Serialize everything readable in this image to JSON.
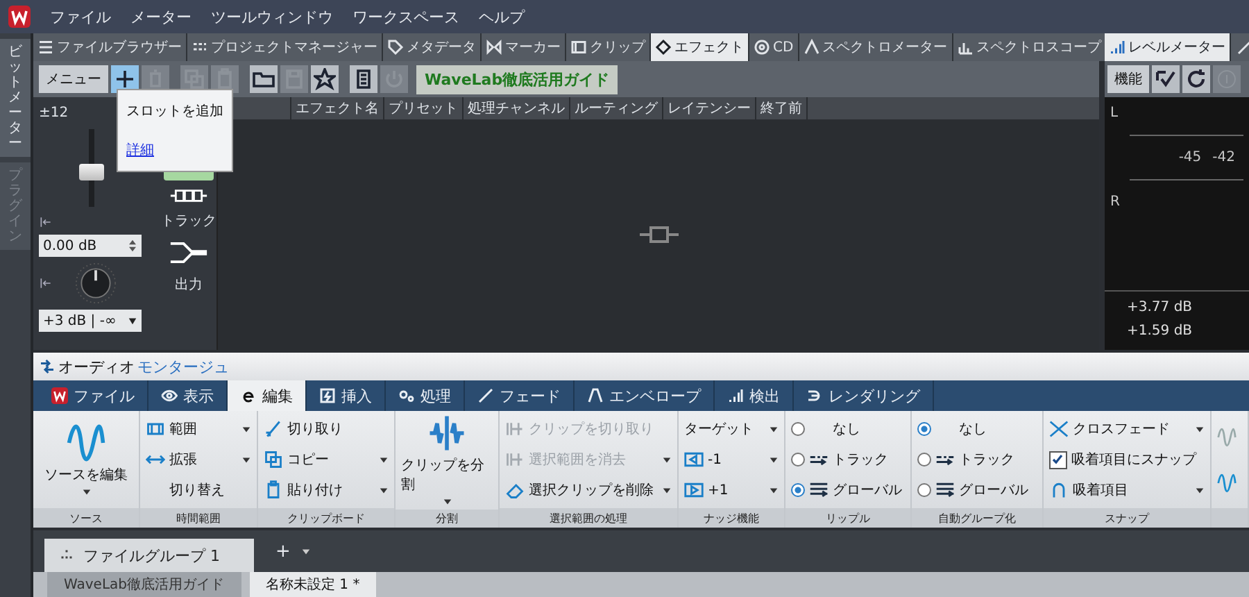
{
  "menu": [
    "ファイル",
    "メーター",
    "ツールウィンドウ",
    "ワークスペース",
    "ヘルプ"
  ],
  "side_tabs": [
    {
      "label": "ビットメーター",
      "selected": true
    },
    {
      "label": "プラグイン",
      "selected": false
    }
  ],
  "tool_tabs": [
    {
      "label": "ファイルブラウザー",
      "selected": false
    },
    {
      "label": "プロジェクトマネージャー",
      "selected": false
    },
    {
      "label": "メタデータ",
      "selected": false
    },
    {
      "label": "マーカー",
      "selected": false
    },
    {
      "label": "クリップ",
      "selected": false
    },
    {
      "label": "エフェクト",
      "selected": true
    },
    {
      "label": "CD",
      "selected": false
    },
    {
      "label": "スペクトロメーター",
      "selected": false
    },
    {
      "label": "スペクトロスコープ",
      "selected": false
    }
  ],
  "toolbar": {
    "menu_button": "メニュー",
    "guide_button": "WaveLab徹底活用ガイド",
    "tools": [
      {
        "kind": "add",
        "disabled": false,
        "selected": true
      },
      {
        "kind": "trash",
        "disabled": true,
        "selected": false
      },
      {
        "kind": "copy",
        "disabled": true,
        "selected": false
      },
      {
        "kind": "paste",
        "disabled": true,
        "selected": false
      },
      {
        "kind": "folder",
        "disabled": false,
        "selected": false
      },
      {
        "kind": "save",
        "disabled": true,
        "selected": false
      },
      {
        "kind": "star",
        "disabled": false,
        "selected": false
      },
      {
        "kind": "doc",
        "disabled": false,
        "selected": false
      },
      {
        "kind": "power",
        "disabled": true,
        "selected": false
      }
    ]
  },
  "tooltip": {
    "text": "スロットを追加",
    "link": "詳細"
  },
  "mixer": {
    "scale": "±12",
    "level": 0.45,
    "gain": "0.00 dB",
    "output_mode": "+3 dB | -∞",
    "track_label": "トラック",
    "output_label": "出力"
  },
  "effect_columns": [
    "エフェクト名",
    "プリセット",
    "処理チャンネル",
    "ルーティング",
    "レイテンシー",
    "終了前"
  ],
  "meter_panel": {
    "tabs": [
      {
        "label": "レベルメーター",
        "selected": true
      }
    ],
    "function_button": "機能",
    "channels": [
      "L",
      "R"
    ],
    "scale": [
      "-45",
      "-42"
    ],
    "readings": [
      "+3.77 dB",
      "+1.59 dB"
    ]
  },
  "montage": {
    "title_parts": [
      {
        "text": "オーディオ",
        "accent": false
      },
      {
        "text": "モンタージュ",
        "accent": true
      }
    ],
    "ribbon_tabs": [
      {
        "label": "ファイル",
        "selected": false
      },
      {
        "label": "表示",
        "selected": false
      },
      {
        "label": "編集",
        "selected": true
      },
      {
        "label": "挿入",
        "selected": false
      },
      {
        "label": "処理",
        "selected": false
      },
      {
        "label": "フェード",
        "selected": false
      },
      {
        "label": "エンベロープ",
        "selected": false
      },
      {
        "label": "検出",
        "selected": false
      },
      {
        "label": "レンダリング",
        "selected": false
      }
    ],
    "groups": [
      {
        "label": "ソース",
        "items": [
          {
            "kind": "large",
            "label": "ソースを編集",
            "dropdown": true,
            "disabled": false
          }
        ]
      },
      {
        "label": "時間範囲",
        "items": [
          {
            "kind": "small",
            "label": "範囲",
            "dropdown": true,
            "disabled": false
          },
          {
            "kind": "small",
            "label": "拡張",
            "dropdown": true,
            "disabled": false
          },
          {
            "kind": "small",
            "label": "切り替え",
            "dropdown": false,
            "disabled": false
          }
        ]
      },
      {
        "label": "クリップボード",
        "items": [
          {
            "kind": "small",
            "label": "切り取り",
            "dropdown": false,
            "disabled": false
          },
          {
            "kind": "small",
            "label": "コピー",
            "dropdown": true,
            "disabled": false
          },
          {
            "kind": "small",
            "label": "貼り付け",
            "dropdown": true,
            "disabled": false
          }
        ]
      },
      {
        "label": "分割",
        "items": [
          {
            "kind": "large",
            "label": "クリップを分割",
            "dropdown": true,
            "disabled": false
          }
        ]
      },
      {
        "label": "選択範囲の処理",
        "items": [
          {
            "kind": "small",
            "label": "クリップを切り取り",
            "dropdown": false,
            "disabled": true
          },
          {
            "kind": "small",
            "label": "選択範囲を消去",
            "dropdown": true,
            "disabled": true
          },
          {
            "kind": "small",
            "label": "選択クリップを削除",
            "dropdown": true,
            "disabled": false
          }
        ]
      },
      {
        "label": "ナッジ機能",
        "items": [
          {
            "kind": "small",
            "label": "ターゲット",
            "dropdown": true,
            "disabled": false
          },
          {
            "kind": "small",
            "label": "-1",
            "dropdown": true,
            "disabled": false
          },
          {
            "kind": "small",
            "label": "+1",
            "dropdown": true,
            "disabled": false
          }
        ]
      },
      {
        "label": "リップル",
        "items": [
          {
            "kind": "radio",
            "label": "なし",
            "selected": false
          },
          {
            "kind": "radio",
            "label": "トラック",
            "selected": false
          },
          {
            "kind": "radio",
            "label": "グローバル",
            "selected": true
          }
        ]
      },
      {
        "label": "自動グループ化",
        "items": [
          {
            "kind": "radio",
            "label": "なし",
            "selected": true
          },
          {
            "kind": "radio",
            "label": "トラック",
            "selected": false
          },
          {
            "kind": "radio",
            "label": "グローバル",
            "selected": false
          }
        ]
      },
      {
        "label": "スナップ",
        "items": [
          {
            "kind": "small",
            "label": "クロスフェード",
            "dropdown": true,
            "disabled": false
          },
          {
            "kind": "check",
            "label": "吸着項目にスナップ",
            "checked": true
          },
          {
            "kind": "small",
            "label": "吸着項目",
            "dropdown": true,
            "disabled": false
          }
        ]
      }
    ],
    "file_groups": [
      {
        "label": "ファイルグループ 1",
        "selected": true
      }
    ],
    "add_button": "+",
    "documents": [
      {
        "label": "WaveLab徹底活用ガイド",
        "selected": false
      },
      {
        "label": "名称未設定 1 *",
        "selected": true
      }
    ]
  }
}
